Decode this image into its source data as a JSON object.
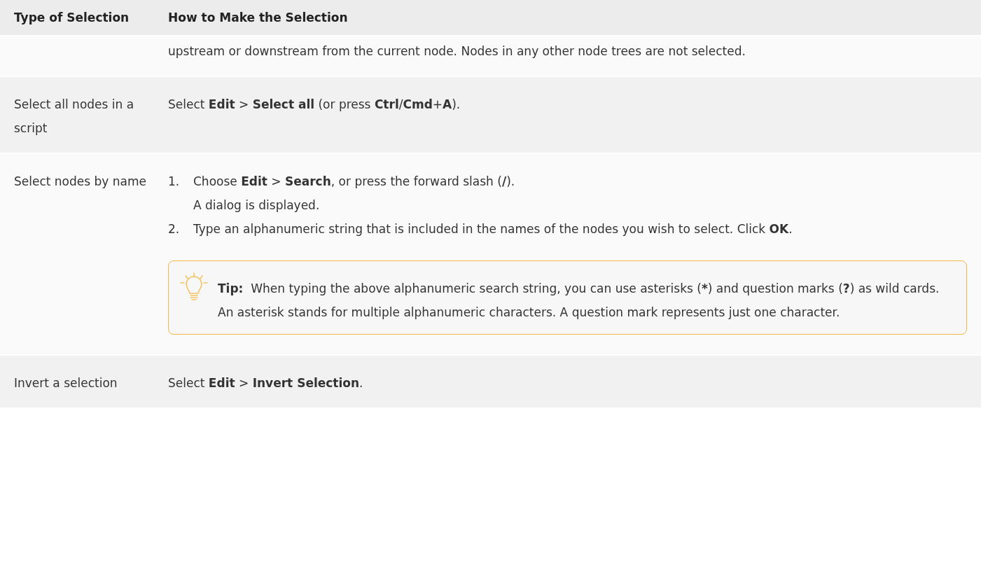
{
  "table": {
    "columns": [
      "Type of Selection",
      "How to Make the Selection"
    ],
    "rows": [
      {
        "how": "upstream or downstream from the current node. Nodes in any other node trees are not selected."
      },
      {
        "type": "Select all nodes in a script",
        "how": "Select **Edit** > **Select all** (or press **Ctrl**/**Cmd**+**A**)."
      },
      {
        "type": "Select nodes by name",
        "steps": [
          {
            "number": "1.",
            "text": "Choose **Edit** > **Search**, or press the forward slash (**/**).",
            "note": "A dialog is displayed."
          },
          {
            "number": "2.",
            "text": "Type an alphanumeric string that is included in the names of the nodes you wish to select. Click **OK**."
          }
        ],
        "tip": {
          "label": "Tip:",
          "parts": [
            {
              "text": "When typing the above alphanumeric search string, you can use asterisks (",
              "bold": false
            },
            {
              "text": "*",
              "bold": true
            },
            {
              "text": ") and question marks (",
              "bold": false
            },
            {
              "text": "?",
              "bold": true
            },
            {
              "text": ") as wild cards. An asterisk stands for multiple alphanumeric characters. A question mark represents just one character.",
              "bold": false
            }
          ]
        }
      },
      {
        "type": "Invert a selection",
        "how": "Select **Edit** > **Invert Selection**."
      }
    ]
  }
}
